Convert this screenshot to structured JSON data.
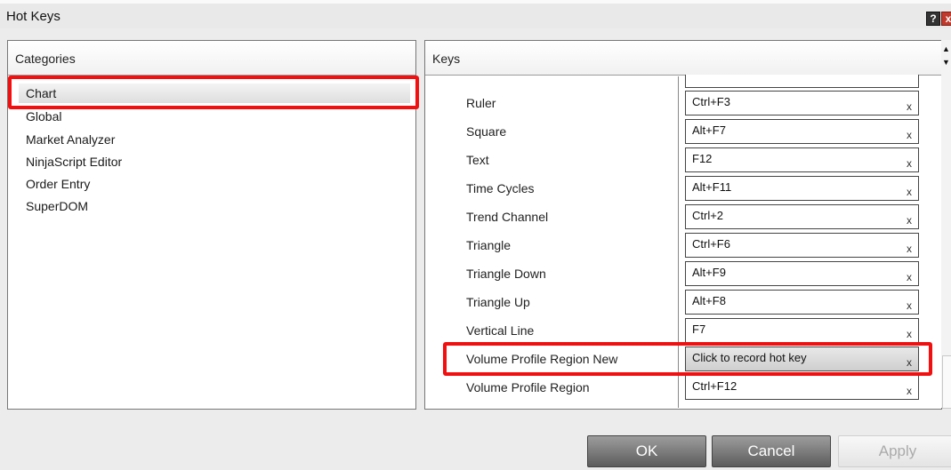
{
  "window": {
    "title": "Hot Keys",
    "help_label": "?",
    "close_label": "x"
  },
  "categories": {
    "header": "Categories",
    "items": [
      {
        "label": "Chart",
        "selected": true
      },
      {
        "label": "Global"
      },
      {
        "label": "Market Analyzer"
      },
      {
        "label": "NinjaScript Editor"
      },
      {
        "label": "Order Entry"
      },
      {
        "label": "SuperDOM"
      }
    ]
  },
  "keys": {
    "header": "Keys",
    "clear_label": "x",
    "rows": [
      {
        "action": "Ruler",
        "key": "Ctrl+F3"
      },
      {
        "action": "Square",
        "key": "Alt+F7"
      },
      {
        "action": "Text",
        "key": "F12"
      },
      {
        "action": "Time Cycles",
        "key": "Alt+F11"
      },
      {
        "action": "Trend Channel",
        "key": "Ctrl+2"
      },
      {
        "action": "Triangle",
        "key": "Ctrl+F6"
      },
      {
        "action": "Triangle Down",
        "key": "Alt+F9"
      },
      {
        "action": "Triangle Up",
        "key": "Alt+F8"
      },
      {
        "action": "Vertical Line",
        "key": "F7"
      },
      {
        "action": "Volume Profile Region New",
        "key": "Click to record hot key",
        "recording": true
      },
      {
        "action": "Volume Profile Region",
        "key": "Ctrl+F12"
      }
    ]
  },
  "scrollbar": {
    "up_icon": "▲",
    "down_icon": "▼"
  },
  "buttons": {
    "ok": "OK",
    "cancel": "Cancel",
    "apply": "Apply",
    "apply_enabled": false
  },
  "highlight_color": "#f20f0f"
}
